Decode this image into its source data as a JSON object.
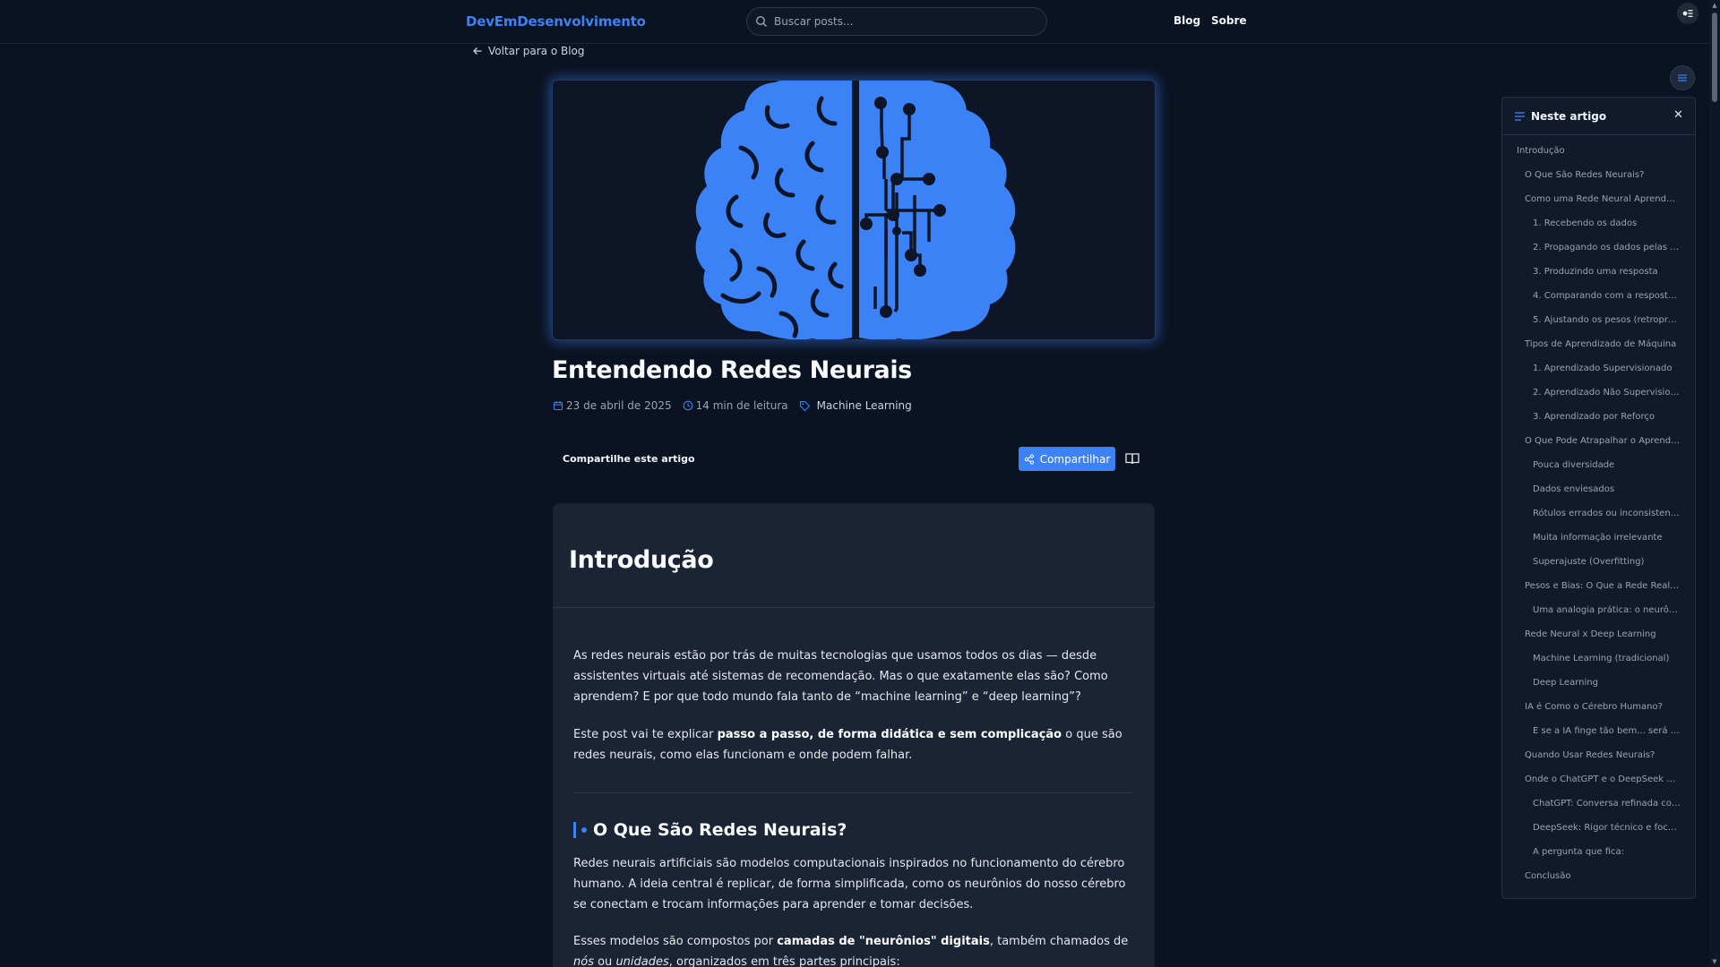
{
  "header": {
    "brand": "DevEmDesenvolvimento",
    "search_placeholder": "Buscar posts...",
    "nav": [
      "Blog",
      "Sobre"
    ],
    "theme_icon": "theme-toggle-icon"
  },
  "back_link": "Voltar para o Blog",
  "article": {
    "title": "Entendendo Redes Neurais",
    "date": "23 de abril de 2025",
    "read_time": "14 min de leitura",
    "category": "Machine Learning",
    "share_label": "Compartilhe este artigo",
    "share_button": "Compartilhar",
    "intro_heading": "Introdução",
    "p1": "As redes neurais estão por trás de muitas tecnologias que usamos todos os dias — desde assistentes virtuais até sistemas de recomendação. Mas o que exatamente elas são? Como aprendem? E por que todo mundo fala tanto de “machine learning” e “deep learning”?",
    "p2_a": "Este post vai te explicar ",
    "p2_b": "passo a passo, de forma didática e sem complicação",
    "p2_c": " o que são redes neurais, como elas funcionam e onde podem falhar.",
    "h2": "O Que São Redes Neurais?",
    "p3": "Redes neurais artificiais são modelos computacionais inspirados no funcionamento do cérebro humano. A ideia central é replicar, de forma simplificada, como os neurônios do nosso cérebro se conectam e trocam informações para aprender e tomar decisões.",
    "p4_a": "Esses modelos são compostos por ",
    "p4_b": "camadas de \"neurônios\" digitais",
    "p4_c": ", também chamados de ",
    "p4_d": "nós",
    "p4_e": " ou ",
    "p4_f": "unidades",
    "p4_g": ", organizados em três partes principais:"
  },
  "toc": {
    "title": "Neste artigo",
    "items": [
      {
        "label": "Introdução",
        "level": 0
      },
      {
        "label": "O Que São Redes Neurais?",
        "level": 1
      },
      {
        "label": "Como uma Rede Neural Aprende (P...",
        "level": 1
      },
      {
        "label": "1. Recebendo os dados",
        "level": 2
      },
      {
        "label": "2. Propagando os dados pelas ca...",
        "level": 2
      },
      {
        "label": "3. Produzindo uma resposta",
        "level": 2
      },
      {
        "label": "4. Comparando com a resposta c...",
        "level": 2
      },
      {
        "label": "5. Ajustando os pesos (retropropa...",
        "level": 2
      },
      {
        "label": "Tipos de Aprendizado de Máquina",
        "level": 1
      },
      {
        "label": "1. Aprendizado Supervisionado",
        "level": 2
      },
      {
        "label": "2. Aprendizado Não Supervisiona...",
        "level": 2
      },
      {
        "label": "3. Aprendizado por Reforço",
        "level": 2
      },
      {
        "label": "O Que Pode Atrapalhar o Aprendiz...",
        "level": 1
      },
      {
        "label": "Pouca diversidade",
        "level": 2
      },
      {
        "label": "Dados enviesados",
        "level": 2
      },
      {
        "label": "Rótulos errados ou inconsistentes",
        "level": 2
      },
      {
        "label": "Muita informação irrelevante",
        "level": 2
      },
      {
        "label": "Superajuste (Overfitting)",
        "level": 2
      },
      {
        "label": "Pesos e Bias: O Que a Rede Realme...",
        "level": 1
      },
      {
        "label": "Uma analogia prática: o neurônio ...",
        "level": 2
      },
      {
        "label": "Rede Neural x Deep Learning",
        "level": 1
      },
      {
        "label": "Machine Learning (tradicional)",
        "level": 2
      },
      {
        "label": "Deep Learning",
        "level": 2
      },
      {
        "label": "IA é Como o Cérebro Humano?",
        "level": 1
      },
      {
        "label": "E se a IA finge tão bem... será que...",
        "level": 2
      },
      {
        "label": "Quando Usar Redes Neurais?",
        "level": 1
      },
      {
        "label": "Onde o ChatGPT e o DeepSeek Ent...",
        "level": 1
      },
      {
        "label": "ChatGPT: Conversa refinada com...",
        "level": 2
      },
      {
        "label": "DeepSeek: Rigor técnico e foco a...",
        "level": 2
      },
      {
        "label": "A pergunta que fica:",
        "level": 2
      },
      {
        "label": "Conclusão",
        "level": 1
      }
    ]
  },
  "colors": {
    "accent": "#3b82f6",
    "background": "#0b1221",
    "card": "#1a2435"
  }
}
